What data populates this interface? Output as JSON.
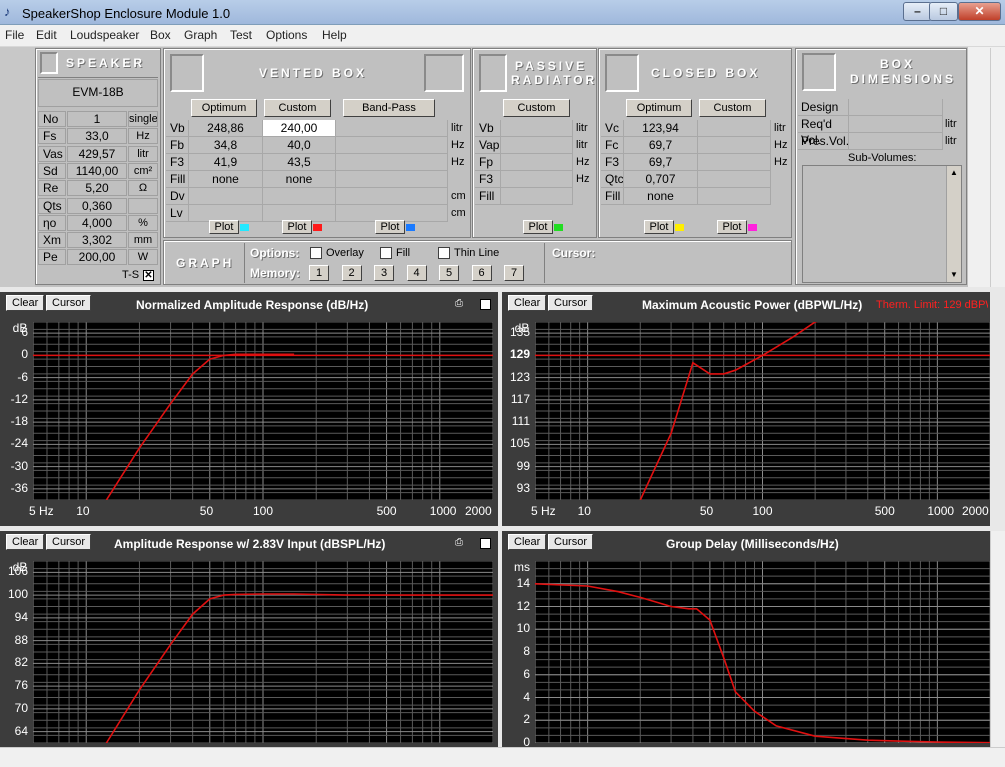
{
  "window": {
    "title": "SpeakerShop Enclosure Module 1.0"
  },
  "menu": [
    "File",
    "Edit",
    "Loudspeaker",
    "Box",
    "Graph",
    "Test",
    "Options",
    "Help"
  ],
  "speaker": {
    "header": "SPEAKER",
    "model": "EVM-18B",
    "rows": [
      {
        "label": "No",
        "value": "1",
        "unit": "single"
      },
      {
        "label": "Fs",
        "value": "33,0",
        "unit": "Hz"
      },
      {
        "label": "Vas",
        "value": "429,57",
        "unit": "litr"
      },
      {
        "label": "Sd",
        "value": "1140,00",
        "unit": "cm²"
      },
      {
        "label": "Re",
        "value": "5,20",
        "unit": "Ω"
      },
      {
        "label": "Qts",
        "value": "0,360",
        "unit": ""
      },
      {
        "label": "ηo",
        "value": "4,000",
        "unit": "%"
      },
      {
        "label": "Xm",
        "value": "3,302",
        "unit": "mm"
      },
      {
        "label": "Pe",
        "value": "200,00",
        "unit": "W"
      }
    ],
    "ts_label": "T-S"
  },
  "vented": {
    "header": "VENTED BOX",
    "buttons": [
      "Optimum",
      "Custom",
      "Band-Pass"
    ],
    "labels": [
      "Vb",
      "Fb",
      "F3",
      "Fill",
      "Dv",
      "Lv"
    ],
    "optimum": [
      "248,86",
      "34,8",
      "41,9",
      "none",
      "",
      ""
    ],
    "custom": [
      "240,00",
      "40,0",
      "43,5",
      "none",
      "",
      ""
    ],
    "units": [
      "litr",
      "Hz",
      "Hz",
      "",
      "cm",
      "cm"
    ],
    "plot": "Plot",
    "colors": [
      "#22e8ff",
      "#ff1a1a",
      "#1a7aff"
    ]
  },
  "passive": {
    "header1": "PASSIVE",
    "header2": "RADIATOR",
    "button": "Custom",
    "labels": [
      "Vb",
      "Vap",
      "Fp",
      "F3",
      "Fill"
    ],
    "units": [
      "litr",
      "litr",
      "Hz",
      "Hz",
      ""
    ],
    "plot": "Plot",
    "color": "#22dd22"
  },
  "closed": {
    "header": "CLOSED BOX",
    "buttons": [
      "Optimum",
      "Custom"
    ],
    "labels": [
      "Vc",
      "Fc",
      "F3",
      "Qtc",
      "Fill"
    ],
    "optimum": [
      "123,94",
      "69,7",
      "69,7",
      "0,707",
      "none"
    ],
    "units": [
      "litr",
      "Hz",
      "Hz",
      "",
      ""
    ],
    "plot": "Plot",
    "colors": [
      "#ffee00",
      "#ff22dd"
    ]
  },
  "box_dims": {
    "header1": "BOX",
    "header2": "DIMENSIONS",
    "rows": [
      {
        "label": "Design",
        "unit": ""
      },
      {
        "label": "Req'd Vol.",
        "unit": "litr"
      },
      {
        "label": "Pres.Vol.",
        "unit": "litr"
      }
    ],
    "subvol": "Sub-Volumes:"
  },
  "graph_opts": {
    "header": "GRAPH",
    "options_label": "Options:",
    "overlay": "Overlay",
    "fill": "Fill",
    "thin": "Thin Line",
    "memory_label": "Memory:",
    "memory": [
      "1",
      "2",
      "3",
      "4",
      "5",
      "6",
      "7"
    ],
    "cursor_label": "Cursor:"
  },
  "graphs": {
    "clear": "Clear",
    "cursor": "Cursor",
    "g1": {
      "title": "Normalized Amplitude Response (dB/Hz)",
      "unit": "dB",
      "yticks": [
        "6",
        "0",
        "-6",
        "-12",
        "-18",
        "-24",
        "-30",
        "-36"
      ]
    },
    "g2": {
      "title": "Maximum Acoustic Power (dBPWL/Hz)",
      "unit": "dB",
      "therm": "Therm. Limit: 129 dBPWL",
      "yticks": [
        "135",
        "129",
        "123",
        "117",
        "111",
        "105",
        "99",
        "93"
      ]
    },
    "g3": {
      "title": "Amplitude Response w/ 2.83V Input (dBSPL/Hz)",
      "unit": "dB",
      "yticks": [
        "106",
        "100",
        "94",
        "88",
        "82",
        "76",
        "70",
        "64"
      ]
    },
    "g4": {
      "title": "Group Delay (Milliseconds/Hz)",
      "unit": "ms",
      "yticks": [
        "14",
        "12",
        "10",
        "8",
        "6",
        "4",
        "2",
        "0"
      ]
    },
    "xticks": [
      "5 Hz",
      "10",
      "50",
      "100",
      "500",
      "1000",
      "2000"
    ]
  },
  "chart_data": [
    {
      "type": "line",
      "title": "Normalized Amplitude Response (dB/Hz)",
      "ylabel": "dB",
      "x_scale": "log",
      "xlim": [
        5,
        2000
      ],
      "ylim": [
        -39,
        9
      ],
      "series": [
        {
          "color": "#e01010",
          "x": [
            13,
            20,
            30,
            40,
            50,
            60,
            70,
            100,
            150
          ],
          "y": [
            -39,
            -25,
            -13,
            -5,
            -1,
            0,
            0.3,
            0.3,
            0.3
          ]
        }
      ],
      "reference_line": 0
    },
    {
      "type": "line",
      "title": "Maximum Acoustic Power (dBPWL/Hz)",
      "ylabel": "dB",
      "x_scale": "log",
      "xlim": [
        5,
        2000
      ],
      "ylim": [
        90,
        138
      ],
      "series": [
        {
          "color": "#e01010",
          "x": [
            20,
            30,
            40,
            50,
            60,
            70,
            100,
            150,
            200,
            300
          ],
          "y": [
            90,
            108,
            127,
            124,
            124,
            125,
            129,
            134,
            138,
            141
          ]
        }
      ],
      "reference_line": 129
    },
    {
      "type": "line",
      "title": "Amplitude Response w/ 2.83V Input (dBSPL/Hz)",
      "ylabel": "dB",
      "x_scale": "log",
      "xlim": [
        5,
        2000
      ],
      "ylim": [
        61,
        109
      ],
      "series": [
        {
          "color": "#e01010",
          "x": [
            13,
            20,
            30,
            40,
            50,
            60,
            70,
            100,
            150,
            300,
            1000,
            2000
          ],
          "y": [
            61,
            75,
            87,
            95,
            99,
            100,
            100.2,
            100.3,
            100.3,
            100,
            100,
            100
          ]
        }
      ]
    },
    {
      "type": "line",
      "title": "Group Delay (Milliseconds/Hz)",
      "ylabel": "ms",
      "x_scale": "log",
      "xlim": [
        5,
        2000
      ],
      "ylim": [
        0,
        16
      ],
      "series": [
        {
          "color": "#e01010",
          "x": [
            5,
            10,
            15,
            20,
            30,
            38,
            42,
            50,
            60,
            70,
            90,
            120,
            200,
            400,
            1000,
            2000
          ],
          "y": [
            14,
            13.8,
            13.3,
            12.8,
            12,
            11.8,
            11.8,
            10.8,
            7.5,
            4.5,
            2.8,
            1.5,
            0.6,
            0.25,
            0.08,
            0.03
          ]
        }
      ]
    }
  ]
}
